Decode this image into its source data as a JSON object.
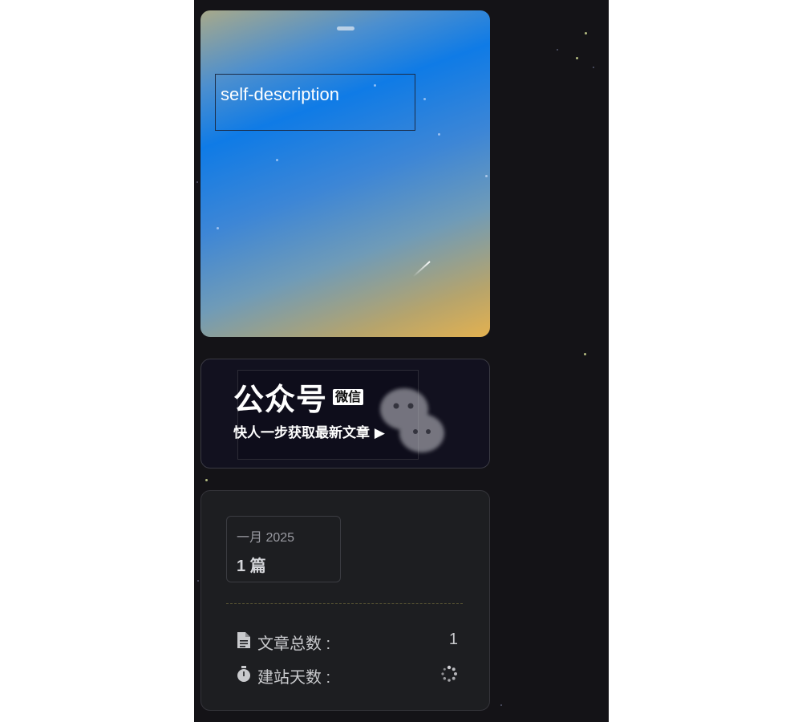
{
  "hero": {
    "description": "self-description"
  },
  "wechat": {
    "title": "公众号",
    "badge": "微信",
    "subtitle": "快人一步获取最新文章 ▶"
  },
  "archive": {
    "month": "一月 2025",
    "count": "1 篇"
  },
  "stats": {
    "articles_label": "文章总数 :",
    "articles_value": "1",
    "days_label": "建站天数 :"
  },
  "colors": {
    "background": "#141317",
    "card": "#1d1e21",
    "accent_gradient_blue": "#0f7be6",
    "accent_gradient_gold": "#e3b150"
  }
}
